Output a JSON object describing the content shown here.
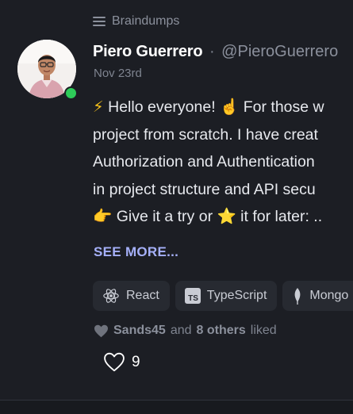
{
  "board": {
    "icon": "hamburger-menu-icon",
    "label": "Braindumps"
  },
  "author": {
    "name": "Piero Guerrero",
    "separator": "·",
    "handle": "@PieroGuerrero",
    "online_status_color": "#2ecc59"
  },
  "post": {
    "date": "Nov 23rd",
    "lines": [
      {
        "emoji": "⚡",
        "text": " Hello everyone! ",
        "emoji2": "☝️",
        "text2": " For those w"
      },
      {
        "text": "project from scratch. I have creat"
      },
      {
        "text": "Authorization and Authentication"
      },
      {
        "text": "in project structure and API secu"
      },
      {
        "emoji": "👉",
        "text": " Give it a try or ",
        "emoji2": "⭐",
        "text2": " it for later: .."
      }
    ],
    "see_more": "SEE MORE..."
  },
  "tags": [
    {
      "icon": "react-icon",
      "label": "React"
    },
    {
      "icon": "typescript-icon",
      "label": "TypeScript"
    },
    {
      "icon": "mongodb-icon",
      "label": "Mongo"
    }
  ],
  "likes": {
    "liked_by_user": "Sands45",
    "and_text": "and",
    "others_text": "8 others",
    "suffix": "liked",
    "count": "9"
  },
  "colors": {
    "background": "#1c1e24",
    "accent_link": "#a5b0f8",
    "tag_background": "#272a31"
  }
}
